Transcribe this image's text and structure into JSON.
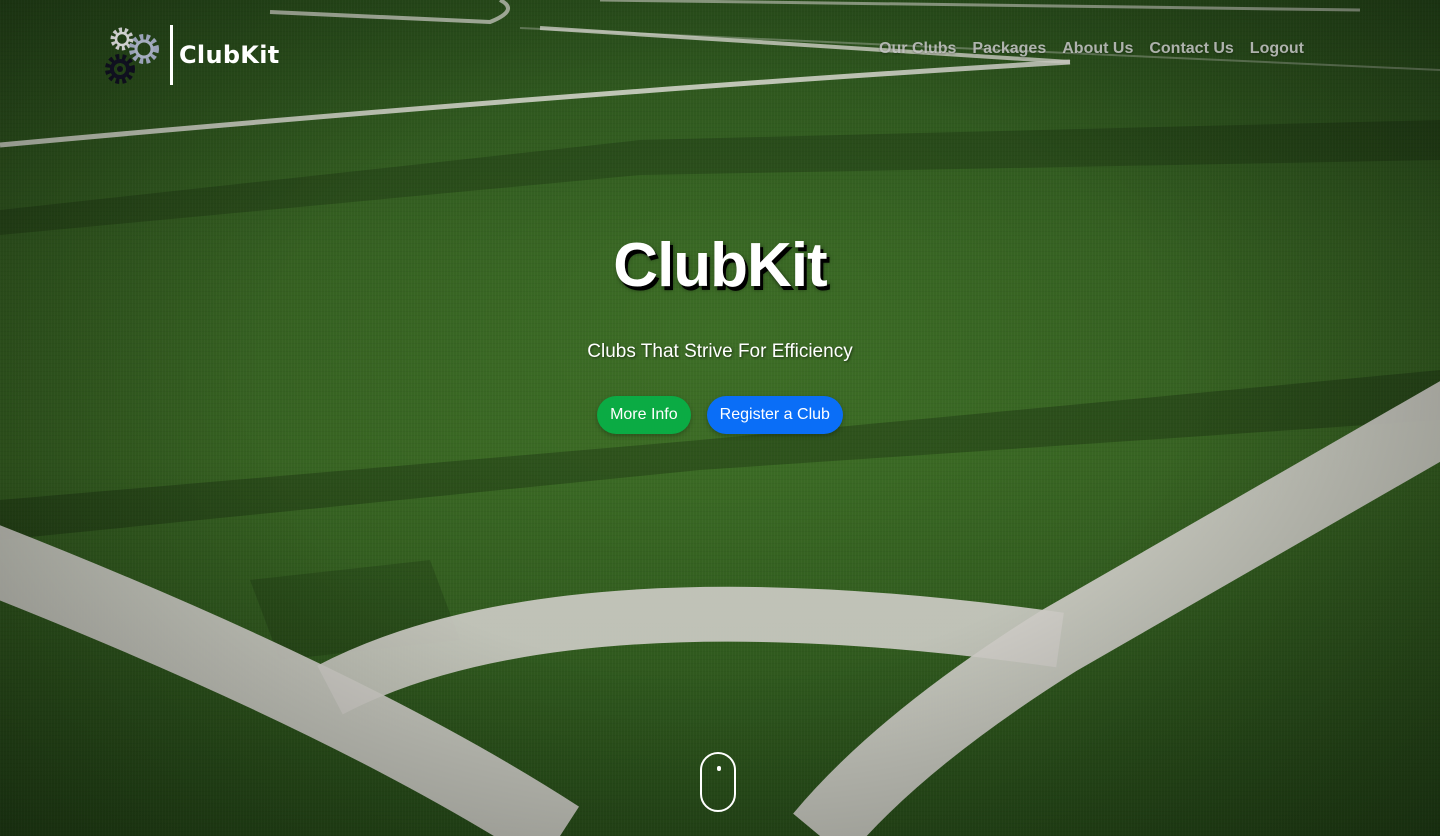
{
  "brand": {
    "logo_text": "ClubKit",
    "logo_icon": "gears-icon"
  },
  "nav": {
    "items": [
      {
        "label": "Our Clubs"
      },
      {
        "label": "Packages"
      },
      {
        "label": "About Us"
      },
      {
        "label": "Contact Us"
      },
      {
        "label": "Logout"
      }
    ]
  },
  "hero": {
    "title": "ClubKit",
    "subtitle": "Clubs That Strive For Efficiency",
    "primary_button": "More Info",
    "secondary_button": "Register a Club",
    "scroll_icon": "mouse-scroll-icon"
  },
  "colors": {
    "green_button": "#0bab44",
    "blue_button": "#0a6ef7",
    "turf": "#3b6b25"
  }
}
